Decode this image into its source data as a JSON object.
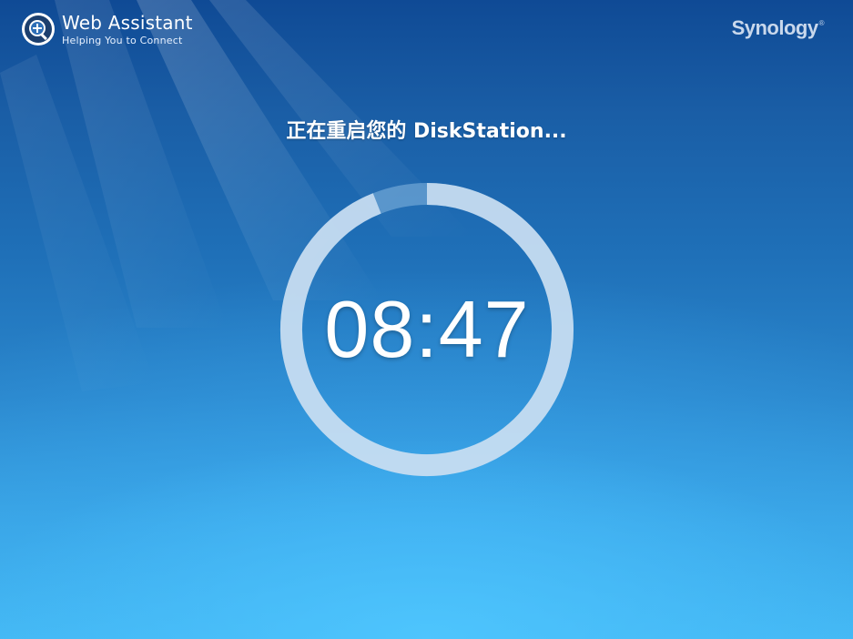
{
  "header": {
    "title": "Web Assistant",
    "subtitle": "Helping You to Connect",
    "logo_icon": "magnifier-plus-icon"
  },
  "brand_logo": {
    "text": "Synology",
    "mark": "®"
  },
  "status": {
    "message": "正在重启您的 DiskStation...",
    "countdown": "08:47",
    "progress_fraction": 0.94
  },
  "colors": {
    "background_top": "#0f4a95",
    "background_bottom": "#45bbf5",
    "ring_track": "#7fb2dc",
    "ring_progress": "#c6dcf0"
  }
}
